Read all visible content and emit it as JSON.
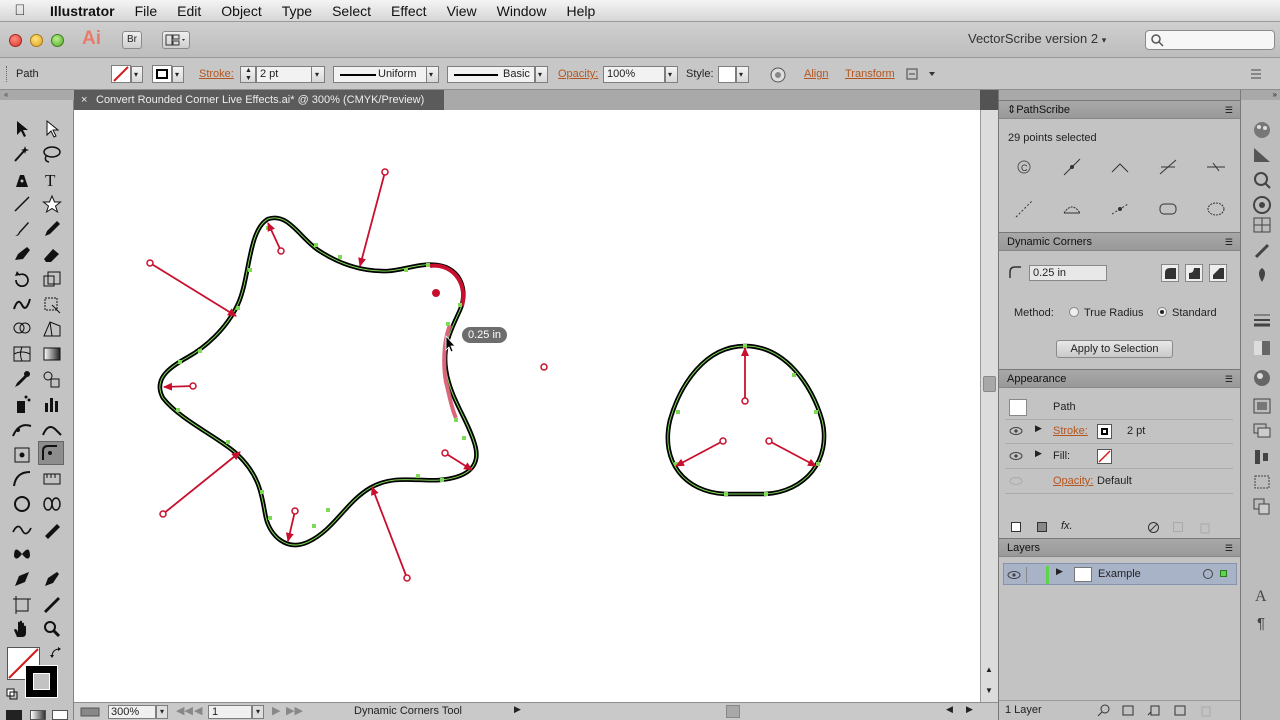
{
  "menubar": {
    "app": "Illustrator",
    "items": [
      "File",
      "Edit",
      "Object",
      "Type",
      "Select",
      "Effect",
      "View",
      "Window",
      "Help"
    ]
  },
  "appbar": {
    "logo": "Ai",
    "bridge": "Br",
    "workspace": "VectorScribe version 2"
  },
  "control": {
    "selection": "Path",
    "stroke_label": "Stroke:",
    "stroke_weight": "2 pt",
    "profile": "Uniform",
    "brush": "Basic",
    "opacity_label": "Opacity:",
    "opacity_value": "100%",
    "style_label": "Style:",
    "align": "Align",
    "transform": "Transform"
  },
  "document": {
    "tab_title": "Convert Rounded Corner Live Effects.ai* @ 300% (CMYK/Preview)",
    "tooltip": "0.25 in"
  },
  "status": {
    "zoom": "300%",
    "artboard": "1",
    "tool": "Dynamic Corners Tool"
  },
  "pathscribe": {
    "title": "PathScribe",
    "info": "29 points selected"
  },
  "dynamic_corners": {
    "title": "Dynamic Corners",
    "radius": "0.25 in",
    "method_label": "Method:",
    "option_true_radius": "True Radius",
    "option_standard": "Standard",
    "apply": "Apply to Selection"
  },
  "appearance": {
    "title": "Appearance",
    "target": "Path",
    "stroke_label": "Stroke:",
    "stroke_value": "2 pt",
    "fill_label": "Fill:",
    "opacity_label": "Opacity:",
    "opacity_value": "Default"
  },
  "layers": {
    "title": "Layers",
    "layer_name": "Example",
    "footer": "1 Layer"
  }
}
